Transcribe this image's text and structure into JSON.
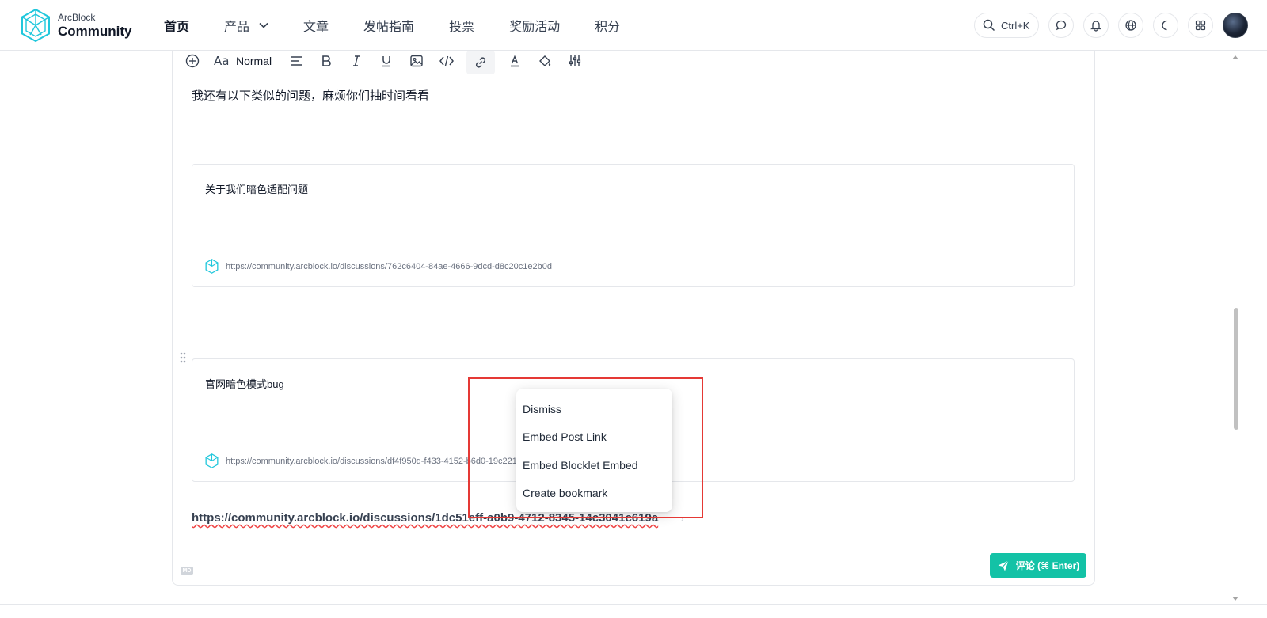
{
  "brand": {
    "top": "ArcBlock",
    "bottom": "Community",
    "color": "#20c7dc"
  },
  "nav": {
    "items": [
      {
        "label": "首页",
        "active": true
      },
      {
        "label": "产品",
        "dropdown": true
      },
      {
        "label": "文章"
      },
      {
        "label": "发帖指南"
      },
      {
        "label": "投票"
      },
      {
        "label": "奖励活动"
      },
      {
        "label": "积分"
      }
    ]
  },
  "header_tools": {
    "search_shortcut": "Ctrl+K"
  },
  "toolbar": {
    "block_type": "Normal"
  },
  "editor": {
    "paragraph": "我还有以下类似的问题，麻烦你们抽时间看看",
    "cards": [
      {
        "title": "关于我们暗色适配问题",
        "url": "https://community.arcblock.io/discussions/762c6404-84ae-4666-9dcd-d8c20c1e2b0d"
      },
      {
        "title": "官网暗色模式bug",
        "url": "https://community.arcblock.io/discussions/df4f950d-f433-4152-b6d0-19c22188f6a0"
      }
    ],
    "pasted_link": "https://community.arcblock.io/discussions/1dc51eff-a0b9-4712-8345-14c3041c619a",
    "md_badge": "MD"
  },
  "popup_menu": {
    "items": [
      "Dismiss",
      "Embed Post Link",
      "Embed Blocklet Embed",
      "Create bookmark"
    ]
  },
  "submit": {
    "label": "评论 (⌘ Enter)",
    "color": "#13c2a6"
  },
  "annotation": {
    "color": "#e53935"
  }
}
